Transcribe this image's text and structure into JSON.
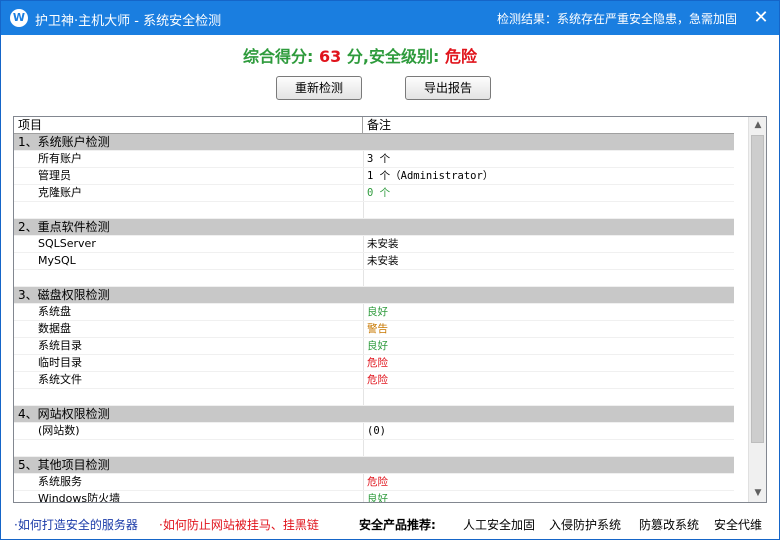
{
  "titlebar": {
    "logo": "W",
    "title": "护卫神·主机大师 - 系统安全检测",
    "result": "检测结果：系统存在严重安全隐患，急需加固",
    "close": "✕"
  },
  "score": {
    "prefix": "综合得分:",
    "value": "63",
    "middle": "分,安全级别:",
    "level": "危险"
  },
  "buttons": {
    "recheck": "重新检测",
    "export": "导出报告"
  },
  "list": {
    "headers": [
      "项目",
      "备注"
    ],
    "rows": [
      {
        "a": "1、系统账户检测",
        "b": "",
        "type": "section"
      },
      {
        "a": "所有账户",
        "b": "3 个",
        "type": "item"
      },
      {
        "a": "管理员",
        "b": "1 个（Administrator）",
        "type": "item"
      },
      {
        "a": "克隆账户",
        "b": "0 个",
        "type": "item",
        "color": "green"
      },
      {
        "a": "",
        "b": "",
        "type": "blank"
      },
      {
        "a": "2、重点软件检测",
        "b": "",
        "type": "section"
      },
      {
        "a": "SQLServer",
        "b": "未安装",
        "type": "item"
      },
      {
        "a": "MySQL",
        "b": "未安装",
        "type": "item"
      },
      {
        "a": "",
        "b": "",
        "type": "blank"
      },
      {
        "a": "3、磁盘权限检测",
        "b": "",
        "type": "section"
      },
      {
        "a": "系统盘",
        "b": "良好",
        "type": "item",
        "color": "green"
      },
      {
        "a": "数据盘",
        "b": "警告",
        "type": "item",
        "color": "orange"
      },
      {
        "a": "系统目录",
        "b": "良好",
        "type": "item",
        "color": "green"
      },
      {
        "a": "临时目录",
        "b": "危险",
        "type": "item",
        "color": "red"
      },
      {
        "a": "系统文件",
        "b": "危险",
        "type": "item",
        "color": "red"
      },
      {
        "a": "",
        "b": "",
        "type": "blank"
      },
      {
        "a": "4、网站权限检测",
        "b": "",
        "type": "section"
      },
      {
        "a": "(网站数)",
        "b": "(0)",
        "type": "item"
      },
      {
        "a": "",
        "b": "",
        "type": "blank"
      },
      {
        "a": "5、其他项目检测",
        "b": "",
        "type": "section"
      },
      {
        "a": "系统服务",
        "b": "危险",
        "type": "item",
        "color": "red"
      },
      {
        "a": "Windows防火墙",
        "b": "良好",
        "type": "item",
        "color": "green"
      }
    ]
  },
  "footer": {
    "link1": "·如何打造安全的服务器",
    "link2": "·如何防止网站被挂马、挂黑链",
    "rec_label": "安全产品推荐:",
    "products": [
      "人工安全加固",
      "入侵防护系统",
      "防篡改系统",
      "安全代维"
    ]
  },
  "colors": {
    "titlebar": "#1a7ee0",
    "green": "#2e9b3c",
    "red": "#e0141c",
    "orange": "#c87800",
    "section_bg": "#c8c8c8"
  }
}
